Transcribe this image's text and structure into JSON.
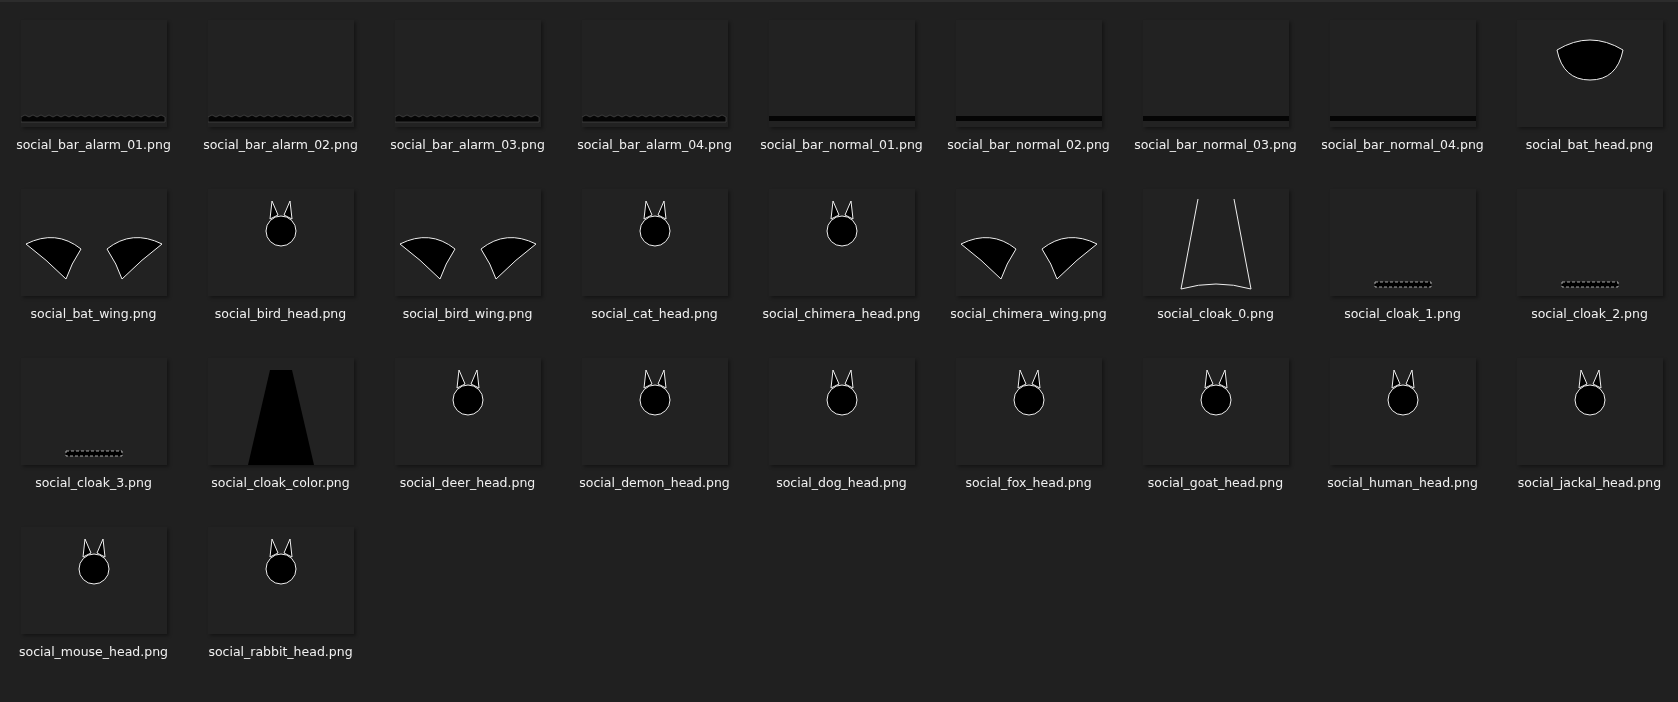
{
  "files": [
    {
      "name": "social_bar_alarm_01.png"
    },
    {
      "name": "social_bar_alarm_02.png"
    },
    {
      "name": "social_bar_alarm_03.png"
    },
    {
      "name": "social_bar_alarm_04.png"
    },
    {
      "name": "social_bar_normal_01.png"
    },
    {
      "name": "social_bar_normal_02.png"
    },
    {
      "name": "social_bar_normal_03.png"
    },
    {
      "name": "social_bar_normal_04.png"
    },
    {
      "name": "social_bat_head.png"
    },
    {
      "name": "social_bat_wing.png"
    },
    {
      "name": "social_bird_head.png"
    },
    {
      "name": "social_bird_wing.png"
    },
    {
      "name": "social_cat_head.png"
    },
    {
      "name": "social_chimera_head.png"
    },
    {
      "name": "social_chimera_wing.png"
    },
    {
      "name": "social_cloak_0.png"
    },
    {
      "name": "social_cloak_1.png"
    },
    {
      "name": "social_cloak_2.png"
    },
    {
      "name": "social_cloak_3.png"
    },
    {
      "name": "social_cloak_color.png"
    },
    {
      "name": "social_deer_head.png"
    },
    {
      "name": "social_demon_head.png"
    },
    {
      "name": "social_dog_head.png"
    },
    {
      "name": "social_fox_head.png"
    },
    {
      "name": "social_goat_head.png"
    },
    {
      "name": "social_human_head.png"
    },
    {
      "name": "social_jackal_head.png"
    },
    {
      "name": "social_mouse_head.png"
    },
    {
      "name": "social_rabbit_head.png"
    }
  ]
}
